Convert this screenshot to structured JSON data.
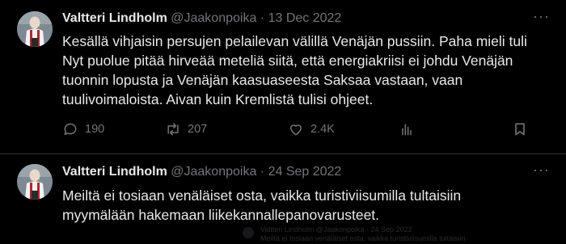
{
  "tweets": [
    {
      "author": "Valtteri Lindholm",
      "handle": "@Jaakonpoika",
      "separator": "·",
      "date": "13 Dec 2022",
      "lines": [
        "Kesällä vihjaisin persujen pelailevan välillä Venäjän pussiin. Paha mieli tuli",
        "Nyt puolue pitää hirveää meteliä siitä, että energiakriisi ei johdu Venäjän",
        "tuonnin lopusta ja Venäjän kaasuaseesta Saksaa vastaan, vaan",
        "tuulivoimaloista. Aivan kuin Kremlistä tulisi ohjeet."
      ],
      "replies": "190",
      "retweets": "207",
      "likes": "2.4K"
    },
    {
      "author": "Valtteri Lindholm",
      "handle": "@Jaakonpoika",
      "separator": "·",
      "date": "24 Sep 2022",
      "lines": [
        "Meiltä ei tosiaan venäläiset osta, vaikka turistiviisumilla tultaisiin",
        "myymälään hakemaan liikekannallepanovarusteet."
      ]
    }
  ],
  "more_label": "···",
  "ghost_preview": {
    "line1": "Valtteri Lindholm @Jaakonpoika · 24 Sep 2022",
    "line2": "Meiltä ei tosiaan venäläiset osta, vaikka turistiviisumilla tultaisiin"
  },
  "icons": {
    "reply": "reply-icon",
    "retweet": "retweet-icon",
    "like": "heart-icon",
    "views": "views-chart-icon",
    "bookmark": "bookmark-icon",
    "share": "share-icon",
    "more": "more-icon"
  },
  "colors": {
    "background": "#000000",
    "text": "#e7e9ea",
    "secondary": "#71767b",
    "divider": "#2f3336"
  }
}
